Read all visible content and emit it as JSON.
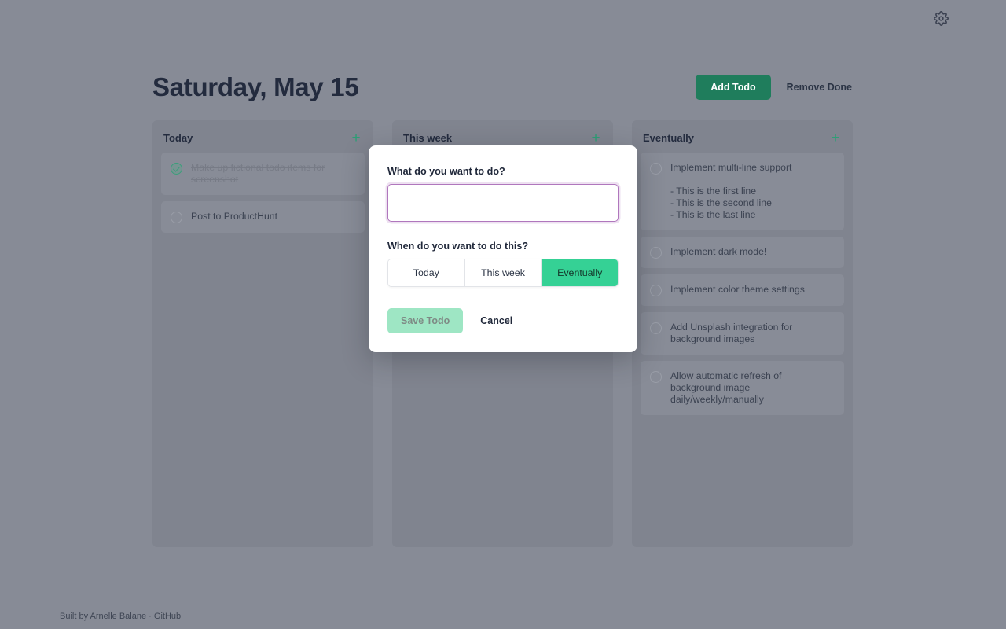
{
  "app": {
    "settings_icon": "gear-icon"
  },
  "header": {
    "title": "Saturday, May 15",
    "add_todo_label": "Add Todo",
    "remove_done_label": "Remove Done",
    "add_icon": "plus-icon"
  },
  "columns": [
    {
      "title": "Today",
      "add_icon": "plus-icon",
      "todos": [
        {
          "text": "Make up fictional todo items for screenshot",
          "completed": true
        },
        {
          "text": "Post to ProductHunt",
          "completed": false
        }
      ]
    },
    {
      "title": "This week",
      "add_icon": "plus-icon",
      "todos": []
    },
    {
      "title": "Eventually",
      "add_icon": "plus-icon",
      "todos": [
        {
          "text": "Implement multi-line support\n\n- This is the first line\n- This is the second line\n- This is the last line",
          "completed": false
        },
        {
          "text": "Implement dark mode!",
          "completed": false
        },
        {
          "text": "Implement color theme settings",
          "completed": false
        },
        {
          "text": "Add Unsplash integration for background images",
          "completed": false
        },
        {
          "text": "Allow automatic refresh of background image daily/weekly/manually",
          "completed": false
        }
      ]
    }
  ],
  "footer": {
    "built_by": "Built by",
    "author": "Arnelle Balane",
    "separator": "·",
    "github": "GitHub"
  },
  "modal": {
    "what_label": "What do you want to do?",
    "input_value": "",
    "input_placeholder": "",
    "when_label": "When do you want to do this?",
    "options": [
      {
        "label": "Today",
        "selected": false
      },
      {
        "label": "This week",
        "selected": false
      },
      {
        "label": "Eventually",
        "selected": true
      }
    ],
    "save_label": "Save Todo",
    "cancel_label": "Cancel",
    "save_disabled": true
  },
  "colors": {
    "background": "#878b96",
    "column": "#80848f",
    "card": "#888c97",
    "accent_green": "#35d195",
    "primary_button": "#1f7d5c",
    "input_border": "#b077bd",
    "title": "#232b3e"
  }
}
